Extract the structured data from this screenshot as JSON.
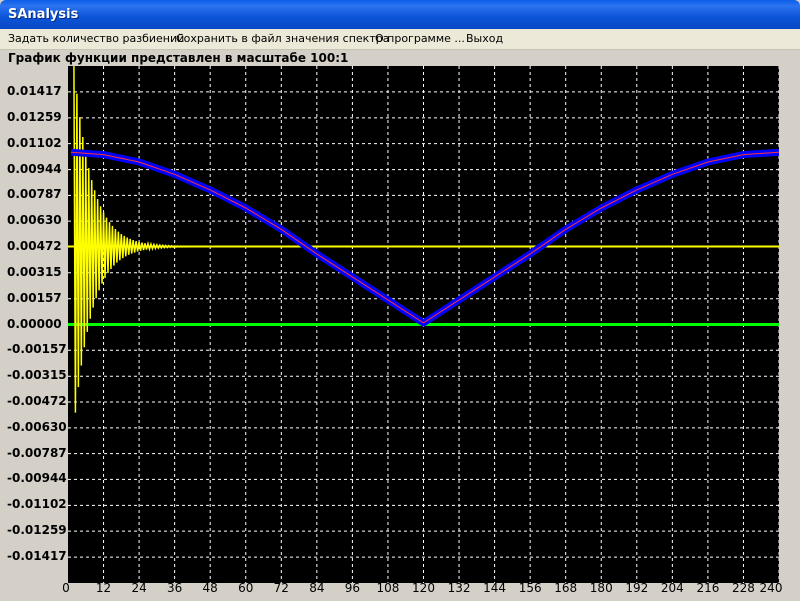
{
  "window": {
    "title": "SAnalysis"
  },
  "menu": [
    {
      "label": "Задать количество разбиений"
    },
    {
      "label": "Сохранить в файл значения спектра"
    },
    {
      "label": "О программе ..."
    },
    {
      "label": "Выход"
    }
  ],
  "caption": "График функции представлен в масштабе 100:1",
  "chart_data": {
    "type": "line",
    "title": "",
    "xlabel": "",
    "ylabel": "",
    "xlim": [
      0,
      240
    ],
    "ylim": [
      -0.01575,
      0.01575
    ],
    "grid": true,
    "x_ticks": [
      0,
      12,
      24,
      36,
      48,
      60,
      72,
      84,
      96,
      108,
      120,
      132,
      144,
      156,
      168,
      180,
      192,
      204,
      216,
      228,
      240
    ],
    "y_ticks": [
      "0.01417",
      "0.01259",
      "0.01102",
      "0.00944",
      "0.00787",
      "0.00630",
      "0.00472",
      "0.00315",
      "0.00157",
      "0.00000",
      "-0.00157",
      "-0.00315",
      "-0.00472",
      "-0.00630",
      "-0.00787",
      "-0.00944",
      "-0.01102",
      "-0.01259",
      "-0.01417"
    ],
    "series": [
      {
        "color": "#0000ff",
        "x": [
          1,
          12,
          24,
          36,
          48,
          60,
          72,
          84,
          96,
          108,
          120,
          132,
          144,
          156,
          168,
          180,
          192,
          204,
          216,
          228,
          240
        ],
        "values": [
          0.0105,
          0.01035,
          0.0099,
          0.00915,
          0.0082,
          0.0071,
          0.0058,
          0.0043,
          0.0029,
          0.0015,
          0.0001,
          0.0015,
          0.0029,
          0.0043,
          0.0058,
          0.0071,
          0.0082,
          0.00915,
          0.0099,
          0.01035,
          0.0105
        ]
      },
      {
        "color": "#ffff00",
        "baseline": 0.00475,
        "start_x": 2,
        "initial_amplitude": 0.011,
        "decay": 6
      },
      {
        "color": "#00ff00",
        "x": [
          0,
          240
        ],
        "values": [
          0.0,
          0.0
        ]
      }
    ]
  }
}
